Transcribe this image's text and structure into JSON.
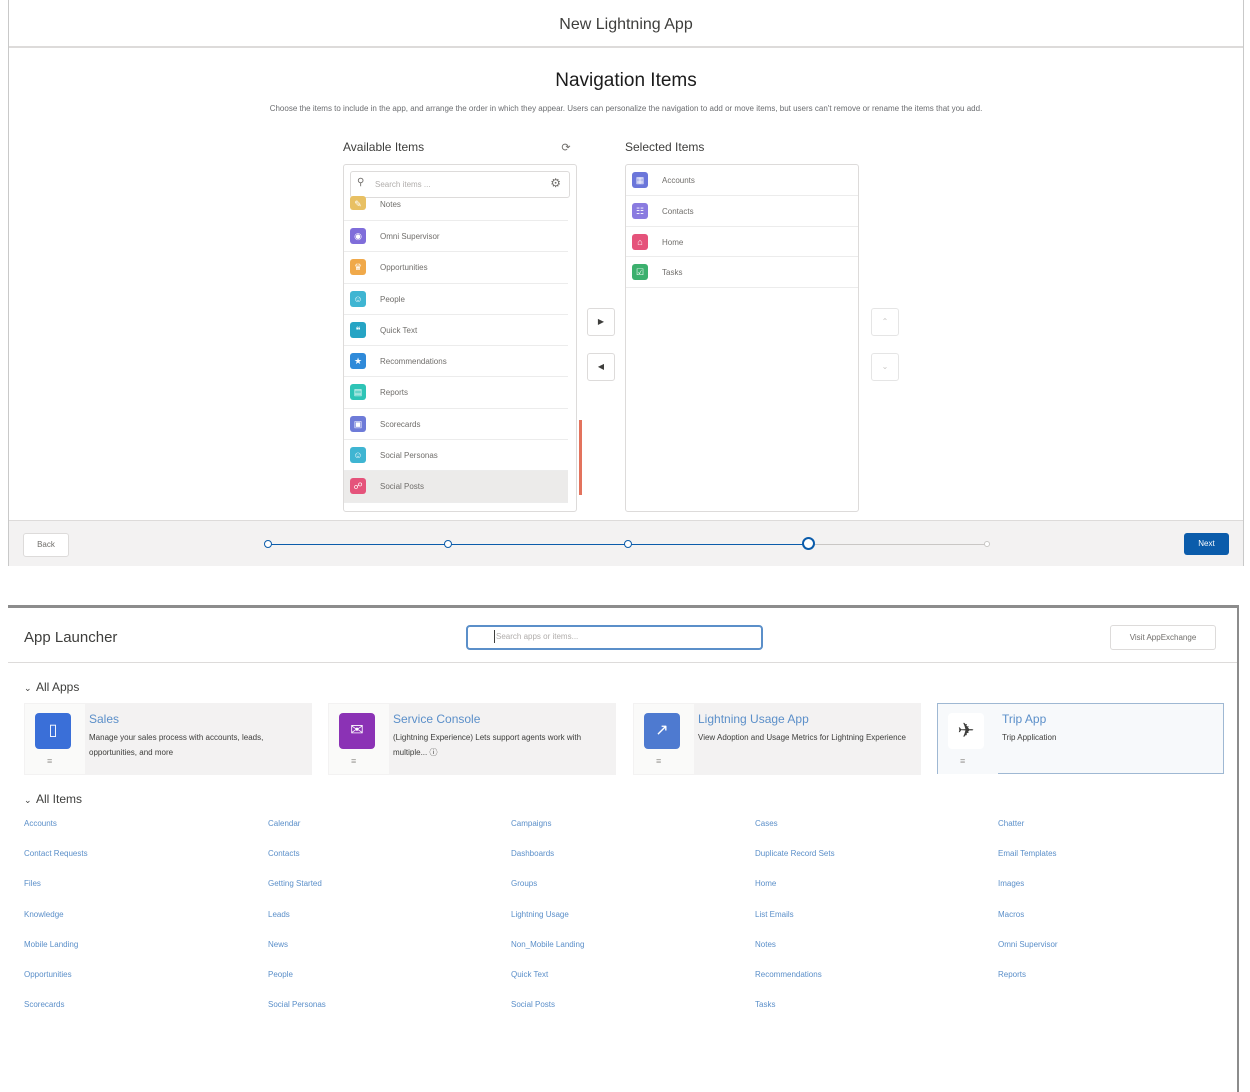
{
  "wizard": {
    "title": "New Lightning App",
    "nav_title": "Navigation Items",
    "description": "Choose the items to include in the app, and arrange the order in which they appear. Users can personalize the navigation to add or move items, but users can't remove or rename the items that you add.",
    "available_label": "Available Items",
    "selected_label": "Selected Items",
    "search_placeholder": "Search items ...",
    "available_items": [
      {
        "label": "Notes",
        "icon": "notes-icon",
        "color": "#e8c063"
      },
      {
        "label": "Omni Supervisor",
        "icon": "omni-icon",
        "color": "#7f6dda"
      },
      {
        "label": "Opportunities",
        "icon": "opportunity-icon",
        "color": "#f0a94a"
      },
      {
        "label": "People",
        "icon": "person-icon",
        "color": "#3fb5d2"
      },
      {
        "label": "Quick Text",
        "icon": "quick-text-icon",
        "color": "#26a4c4"
      },
      {
        "label": "Recommendations",
        "icon": "recommendation-icon",
        "color": "#2f8ad9"
      },
      {
        "label": "Reports",
        "icon": "report-icon",
        "color": "#2ec4b6"
      },
      {
        "label": "Scorecards",
        "icon": "scorecard-icon",
        "color": "#6e7bd8"
      },
      {
        "label": "Social Personas",
        "icon": "social-persona-icon",
        "color": "#3fb5d2"
      },
      {
        "label": "Social Posts",
        "icon": "social-post-icon",
        "color": "#e5537b"
      }
    ],
    "selected_items": [
      {
        "label": "Accounts",
        "icon": "account-icon",
        "color": "#6b76da"
      },
      {
        "label": "Contacts",
        "icon": "contact-icon",
        "color": "#8a7be0"
      },
      {
        "label": "Home",
        "icon": "home-icon",
        "color": "#e5537b"
      },
      {
        "label": "Tasks",
        "icon": "task-icon",
        "color": "#3cb06e"
      }
    ],
    "back_label": "Back",
    "next_label": "Next",
    "progress_step": 4,
    "progress_total": 5
  },
  "launcher": {
    "title": "App Launcher",
    "search_placeholder": "Search apps or items...",
    "appexchange_label": "Visit AppExchange",
    "all_apps_label": "All Apps",
    "all_items_label": "All Items",
    "apps": [
      {
        "name": "Sales",
        "description": "Manage your sales process with accounts, leads, opportunities, and more",
        "icon": "phone-icon",
        "color": "#3a6fd8"
      },
      {
        "name": "Service Console",
        "description": "(Lightning Experience) Lets support agents work with multiple...",
        "icon": "chat-icon",
        "color": "#8b32b5"
      },
      {
        "name": "Lightning Usage App",
        "description": "View Adoption and Usage Metrics for Lightning Experience",
        "icon": "chart-icon",
        "color": "#4e7ad0"
      },
      {
        "name": "Trip App",
        "description": "Trip Application",
        "icon": "traveler-icon",
        "color": "#ffffff"
      }
    ],
    "item_columns": [
      [
        "Accounts",
        "Contact Requests",
        "Files",
        "Knowledge",
        "Mobile Landing",
        "Opportunities",
        "Scorecards"
      ],
      [
        "Calendar",
        "Contacts",
        "Getting Started",
        "Leads",
        "News",
        "People",
        "Social Personas"
      ],
      [
        "Campaigns",
        "Dashboards",
        "Groups",
        "Lightning Usage",
        "Non_Mobile Landing",
        "Quick Text",
        "Social Posts"
      ],
      [
        "Cases",
        "Duplicate Record Sets",
        "Home",
        "List Emails",
        "Notes",
        "Recommendations",
        "Tasks"
      ],
      [
        "Chatter",
        "Email Templates",
        "Images",
        "Macros",
        "Omni Supervisor",
        "Reports"
      ]
    ]
  }
}
